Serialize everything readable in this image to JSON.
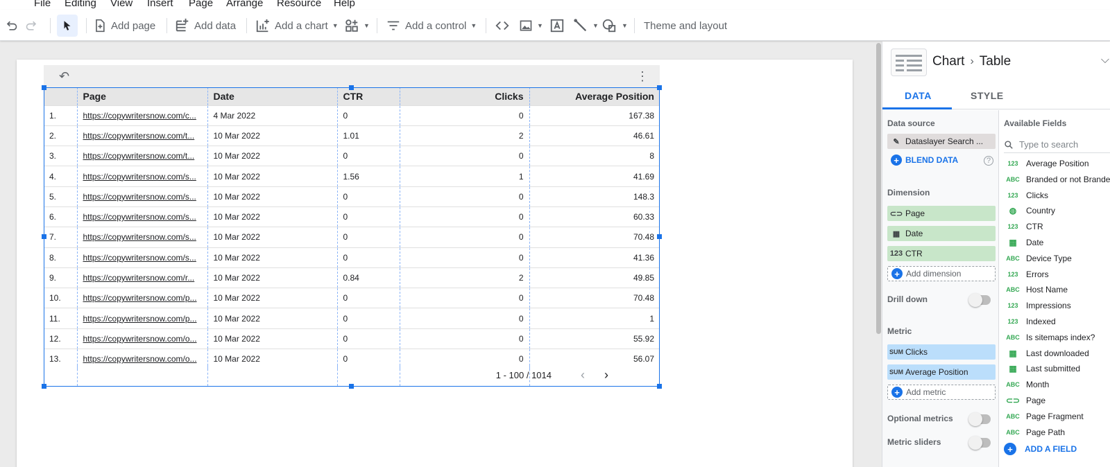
{
  "menu": [
    "File",
    "Editing",
    "View",
    "Insert",
    "Page",
    "Arrange",
    "Resource",
    "Help"
  ],
  "toolbar": {
    "add_page": "Add page",
    "add_data": "Add data",
    "add_chart": "Add a chart",
    "add_control": "Add a control",
    "theme_layout": "Theme and layout"
  },
  "table": {
    "columns": [
      "Page",
      "Date",
      "CTR",
      "Clicks",
      "Average Position"
    ],
    "rows": [
      [
        "1.",
        "https://copywritersnow.com/c...",
        "4 Mar 2022",
        "0",
        "0",
        "167.38"
      ],
      [
        "2.",
        "https://copywritersnow.com/t...",
        "10 Mar 2022",
        "1.01",
        "2",
        "46.61"
      ],
      [
        "3.",
        "https://copywritersnow.com/t...",
        "10 Mar 2022",
        "0",
        "0",
        "8"
      ],
      [
        "4.",
        "https://copywritersnow.com/s...",
        "10 Mar 2022",
        "1.56",
        "1",
        "41.69"
      ],
      [
        "5.",
        "https://copywritersnow.com/s...",
        "10 Mar 2022",
        "0",
        "0",
        "148.3"
      ],
      [
        "6.",
        "https://copywritersnow.com/s...",
        "10 Mar 2022",
        "0",
        "0",
        "60.33"
      ],
      [
        "7.",
        "https://copywritersnow.com/s...",
        "10 Mar 2022",
        "0",
        "0",
        "70.48"
      ],
      [
        "8.",
        "https://copywritersnow.com/s...",
        "10 Mar 2022",
        "0",
        "0",
        "41.36"
      ],
      [
        "9.",
        "https://copywritersnow.com/r...",
        "10 Mar 2022",
        "0.84",
        "2",
        "49.85"
      ],
      [
        "10.",
        "https://copywritersnow.com/p...",
        "10 Mar 2022",
        "0",
        "0",
        "70.48"
      ],
      [
        "11.",
        "https://copywritersnow.com/p...",
        "10 Mar 2022",
        "0",
        "0",
        "1"
      ],
      [
        "12.",
        "https://copywritersnow.com/o...",
        "10 Mar 2022",
        "0",
        "0",
        "55.92"
      ],
      [
        "13.",
        "https://copywritersnow.com/o...",
        "10 Mar 2022",
        "0",
        "0",
        "56.07"
      ]
    ],
    "pagination": "1 - 100 / 1014"
  },
  "panel": {
    "crumb_chart": "Chart",
    "crumb_table": "Table",
    "tab_data": "DATA",
    "tab_style": "STYLE",
    "data_source_title": "Data source",
    "data_source": "Dataslayer Search ...",
    "blend_data": "BLEND DATA",
    "dimension_title": "Dimension",
    "dimensions": [
      {
        "icon": "link-icon",
        "label": "Page"
      },
      {
        "icon": "calendar-icon",
        "label": "Date"
      },
      {
        "icon": "number-icon",
        "label": "CTR"
      }
    ],
    "add_dimension": "Add dimension",
    "drill_down": "Drill down",
    "metric_title": "Metric",
    "metrics": [
      {
        "agg": "SUM",
        "label": "Clicks"
      },
      {
        "agg": "SUM",
        "label": "Average Position"
      }
    ],
    "add_metric": "Add metric",
    "optional_metrics": "Optional metrics",
    "metric_sliders": "Metric sliders",
    "available_fields_title": "Available Fields",
    "search_placeholder": "Type to search",
    "fields": [
      {
        "type": "123",
        "label": "Average Position"
      },
      {
        "type": "ABC",
        "label": "Branded or not Branded"
      },
      {
        "type": "123",
        "label": "Clicks"
      },
      {
        "type": "globe",
        "label": "Country"
      },
      {
        "type": "123",
        "label": "CTR"
      },
      {
        "type": "date",
        "label": "Date"
      },
      {
        "type": "ABC",
        "label": "Device Type"
      },
      {
        "type": "123",
        "label": "Errors"
      },
      {
        "type": "ABC",
        "label": "Host Name"
      },
      {
        "type": "123",
        "label": "Impressions"
      },
      {
        "type": "123",
        "label": "Indexed"
      },
      {
        "type": "ABC",
        "label": "Is sitemaps index?"
      },
      {
        "type": "date",
        "label": "Last downloaded"
      },
      {
        "type": "date",
        "label": "Last submitted"
      },
      {
        "type": "ABC",
        "label": "Month"
      },
      {
        "type": "link",
        "label": "Page"
      },
      {
        "type": "ABC",
        "label": "Page Fragment"
      },
      {
        "type": "ABC",
        "label": "Page Path"
      }
    ],
    "add_field": "ADD A FIELD"
  },
  "colors": {
    "accent": "#1a73e8",
    "dimension_chip": "#c8e6c9",
    "metric_chip": "#bbdefb",
    "field_type": "#34a853"
  }
}
